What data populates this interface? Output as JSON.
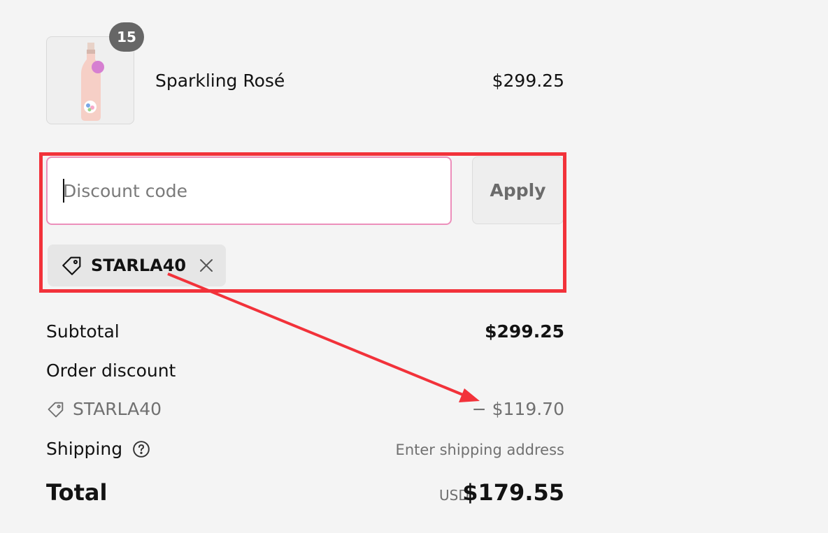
{
  "product": {
    "quantity": "15",
    "name": "Sparkling Rosé",
    "price": "$299.25",
    "image_icon": "wine-bottle-icon"
  },
  "discount": {
    "placeholder": "Discount code",
    "apply_label": "Apply",
    "applied_code": "STARLA40",
    "tag_icon": "tag-icon",
    "remove_icon": "close-icon"
  },
  "summary": {
    "subtotal_label": "Subtotal",
    "subtotal_value": "$299.25",
    "order_discount_label": "Order discount",
    "discount_code": "STARLA40",
    "discount_value": "− $119.70",
    "shipping_label": "Shipping",
    "shipping_value": "Enter shipping address",
    "total_label": "Total",
    "currency": "USD",
    "total_value": "$179.55"
  },
  "colors": {
    "annotation": "#f2323a",
    "input_focus_border": "#ec8fbb",
    "badge": "#666666",
    "background": "#f4f4f4"
  }
}
